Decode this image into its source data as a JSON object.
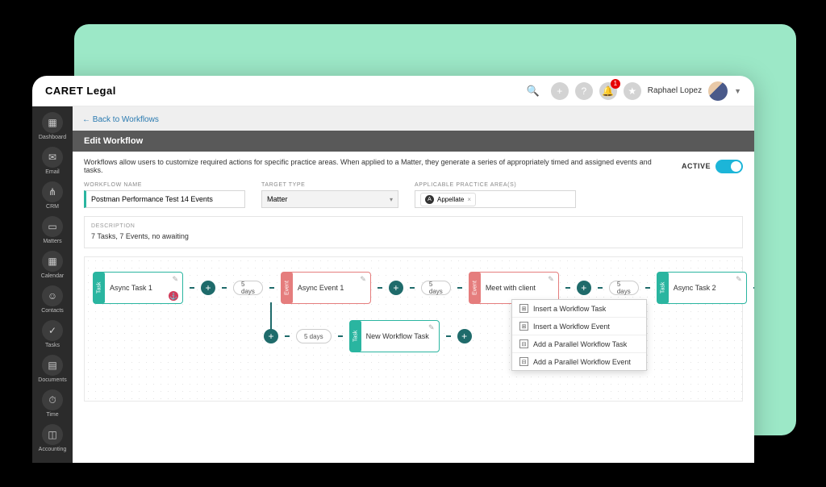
{
  "brand": "CARET Legal",
  "user": {
    "name": "Raphael Lopez",
    "notif_count": "1"
  },
  "nav": [
    {
      "label": "Dashboard",
      "icon": "▦"
    },
    {
      "label": "Email",
      "icon": "✉"
    },
    {
      "label": "CRM",
      "icon": "⋔"
    },
    {
      "label": "Matters",
      "icon": "▭"
    },
    {
      "label": "Calendar",
      "icon": "▦"
    },
    {
      "label": "Contacts",
      "icon": "☺"
    },
    {
      "label": "Tasks",
      "icon": "✓"
    },
    {
      "label": "Documents",
      "icon": "▤"
    },
    {
      "label": "Time",
      "icon": "⏱"
    },
    {
      "label": "Accounting",
      "icon": "◫"
    }
  ],
  "crumb": "←  Back to Workflows",
  "section_title": "Edit Workflow",
  "intro": "Workflows allow users to customize required actions for specific practice areas. When applied to a Matter, they generate a series of appropriately timed and assigned events and tasks.",
  "active_label": "ACTIVE",
  "fields": {
    "name_label": "WORKFLOW NAME",
    "name_value": "Postman Performance Test  14 Events",
    "target_label": "TARGET TYPE",
    "target_value": "Matter",
    "pa_label": "APPLICABLE PRACTICE AREA(S)",
    "pa_value": "Appellate"
  },
  "desc_label": "DESCRIPTION",
  "desc_value": "7 Tasks, 7 Events, no awaiting",
  "delay": "5 days",
  "nodes": {
    "task_side": "Task",
    "event_side": "Event",
    "n1": "Async Task 1",
    "n2": "Async Event 1",
    "n3": "Meet with client",
    "n4": "Async Task 2",
    "n5": "New Workflow Task"
  },
  "menu": {
    "i1": "Insert a Workflow Task",
    "i2": "Insert a Workflow Event",
    "i3": "Add a Parallel Workflow Task",
    "i4": "Add a Parallel Workflow Event"
  }
}
